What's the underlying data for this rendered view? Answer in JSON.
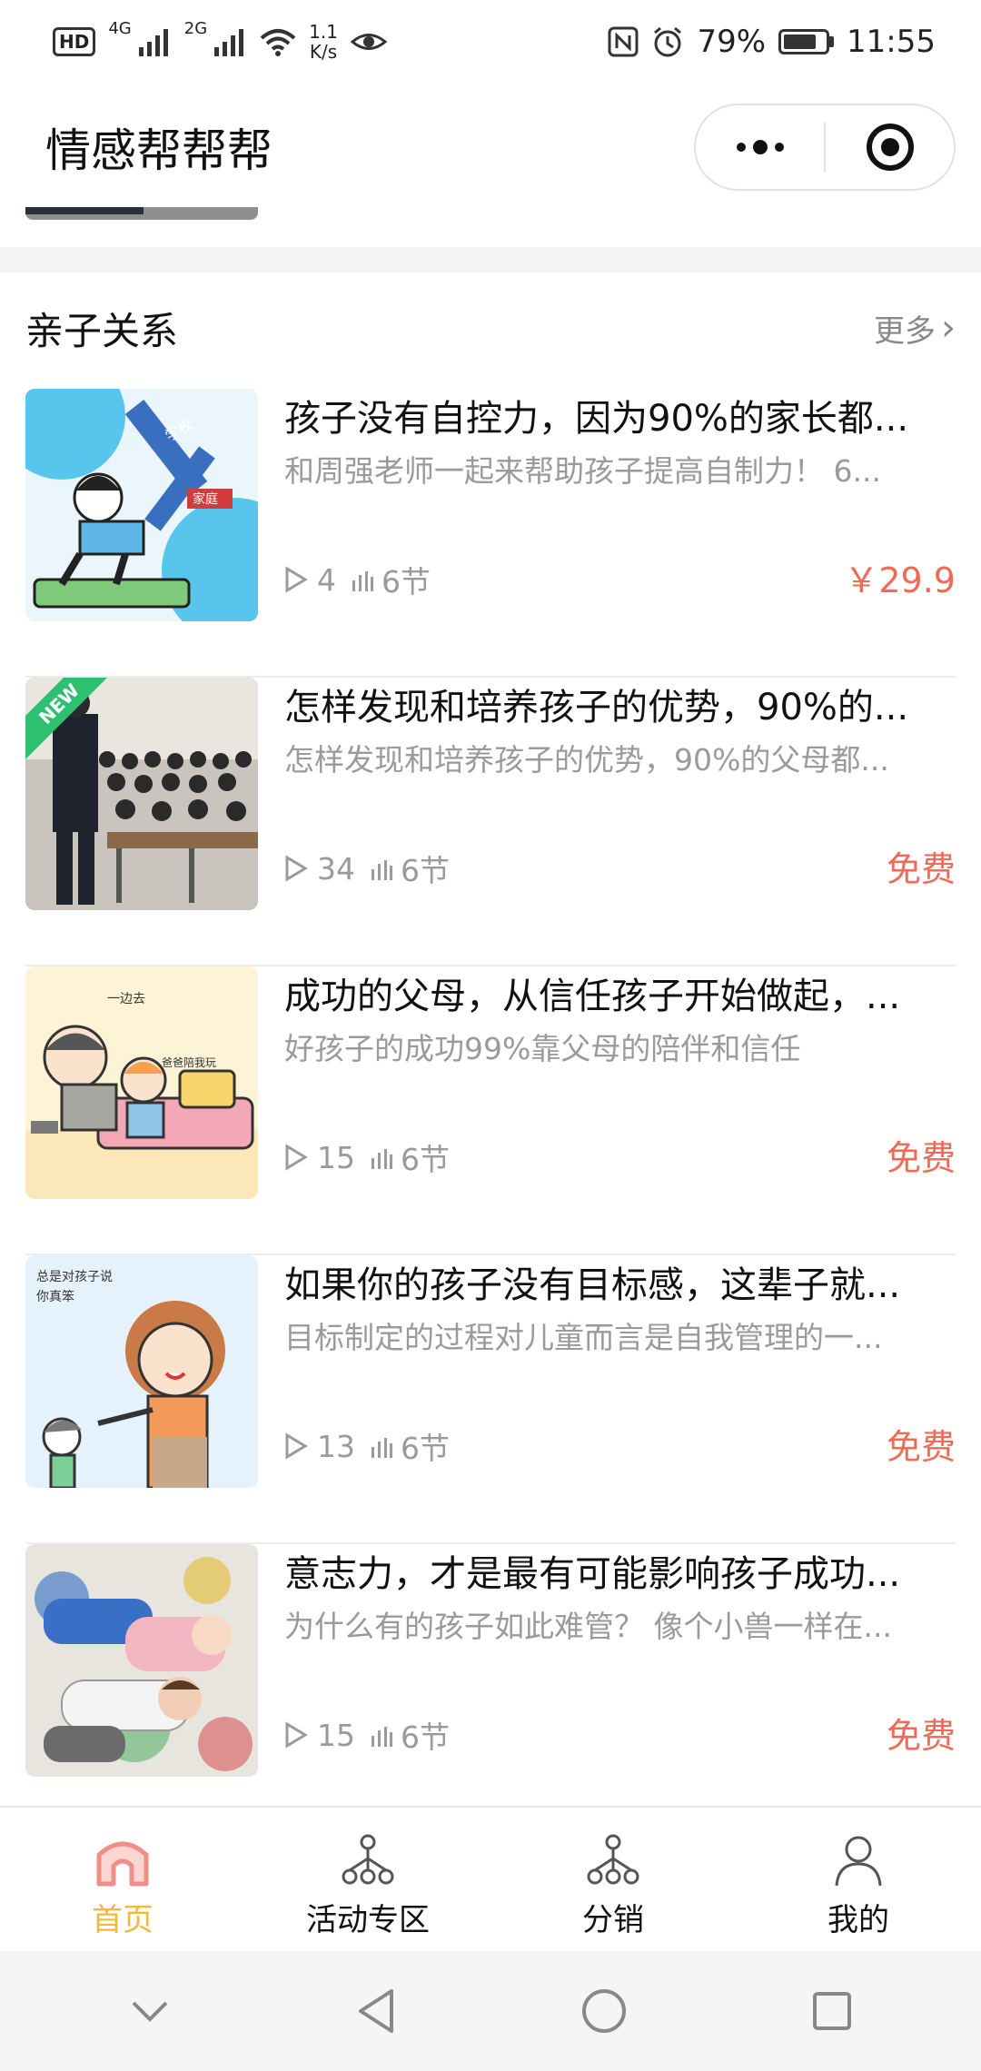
{
  "status_bar": {
    "hd": "HD",
    "net1": "4G",
    "net2": "2G",
    "speed_value": "1.1",
    "speed_unit": "K/s",
    "battery": "79%",
    "time": "11:55"
  },
  "header": {
    "title": "情感帮帮帮"
  },
  "section": {
    "title": "亲子关系",
    "more_label": "更多"
  },
  "courses": [
    {
      "title": "孩子没有自控力，因为90%的家长都...",
      "desc": "和周强老师一起来帮助孩子提高自制力！  6...",
      "plays": "4",
      "lessons": "6节",
      "price": "￥29.9",
      "new": false
    },
    {
      "title": "怎样发现和培养孩子的优势，90%的...",
      "desc": "怎样发现和培养孩子的优势，90%的父母都...",
      "plays": "34",
      "lessons": "6节",
      "price": "免费",
      "new": true,
      "badge": "NEW"
    },
    {
      "title": "成功的父母，从信任孩子开始做起，...",
      "desc": "好孩子的成功99%靠父母的陪伴和信任",
      "plays": "15",
      "lessons": "6节",
      "price": "免费",
      "new": false
    },
    {
      "title": "如果你的孩子没有目标感，这辈子就...",
      "desc": "目标制定的过程对儿童而言是自我管理的一...",
      "plays": "13",
      "lessons": "6节",
      "price": "免费",
      "new": false
    },
    {
      "title": "意志力，才是最有可能影响孩子成功...",
      "desc": "为什么有的孩子如此难管？  像个小兽一样在...",
      "plays": "15",
      "lessons": "6节",
      "price": "免费",
      "new": false
    }
  ],
  "thumb_texts": {
    "c1_sign1": "学校",
    "c1_sign2": "家庭",
    "c3_text1": "一边去",
    "c3_text2": "爸爸陪我玩",
    "c4_text1": "总是对孩子说",
    "c4_text2": "你真笨"
  },
  "tabbar": {
    "items": [
      {
        "label": "首页",
        "active": true
      },
      {
        "label": "活动专区",
        "active": false
      },
      {
        "label": "分销",
        "active": false
      },
      {
        "label": "我的",
        "active": false
      }
    ]
  },
  "colors": {
    "accent": "#f3b73c",
    "price": "#ef6a57",
    "home_icon": "#ef8f88"
  }
}
